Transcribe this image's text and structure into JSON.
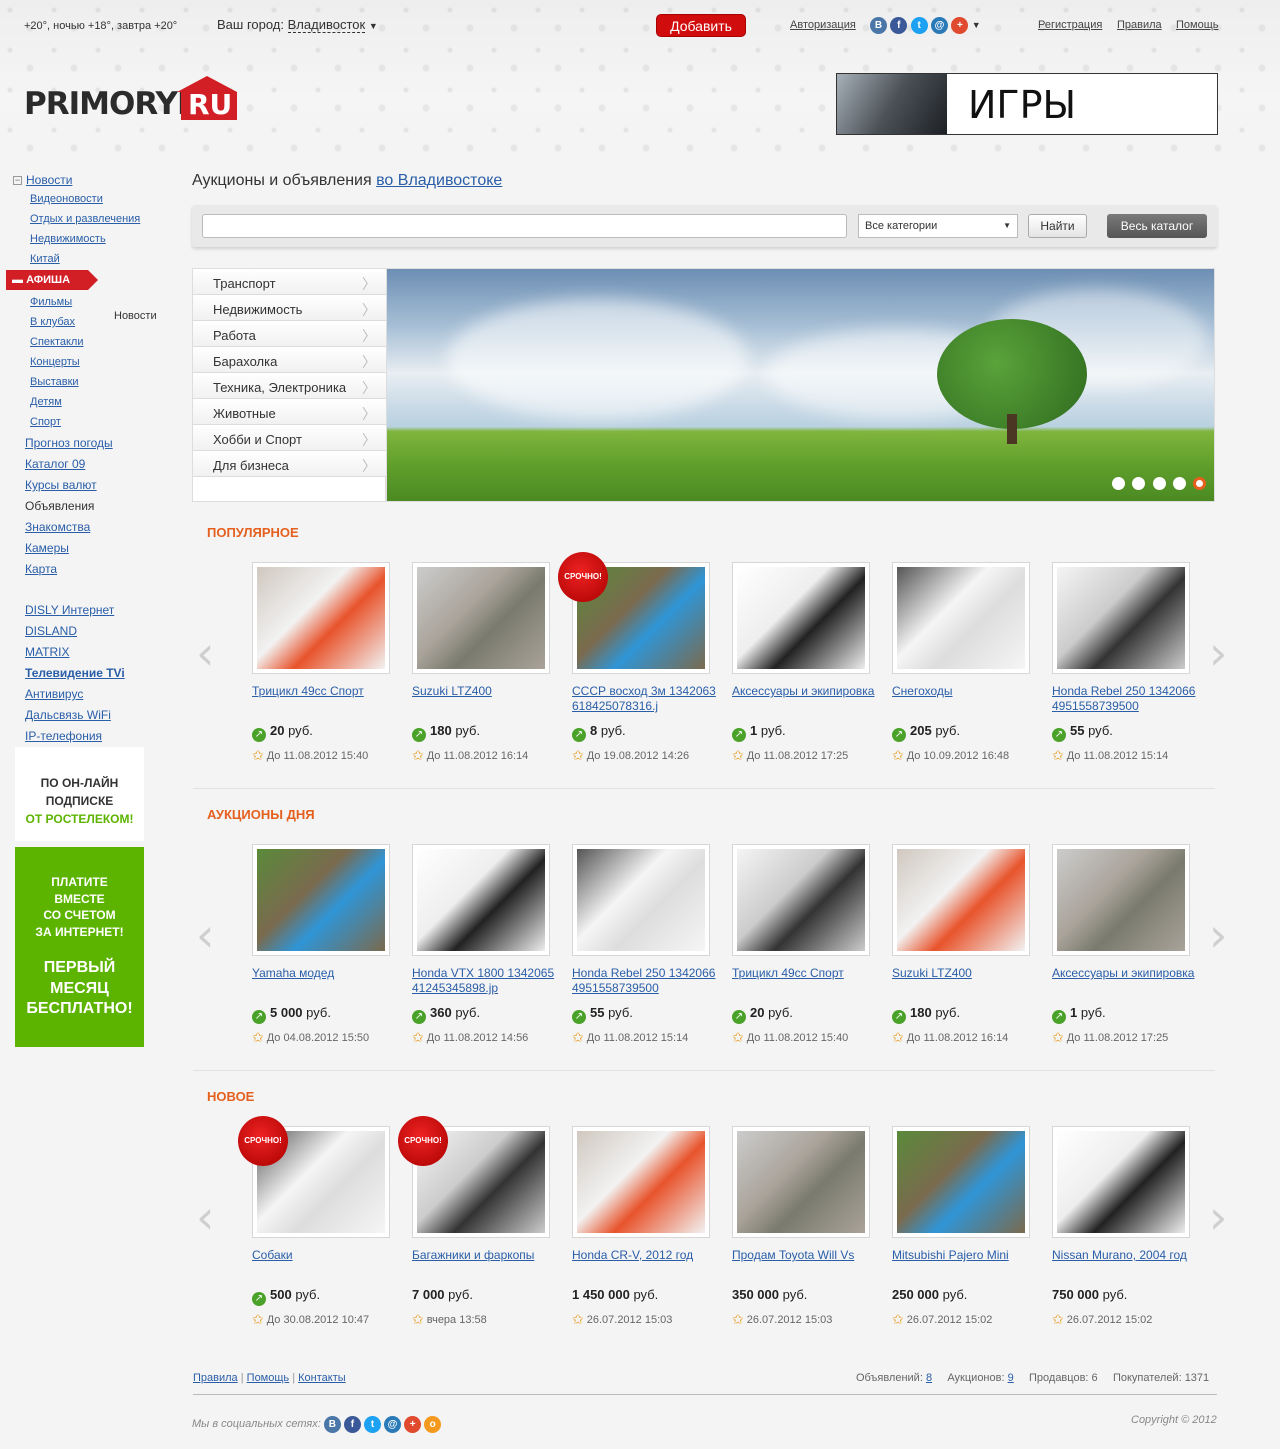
{
  "header": {
    "weather": "+20°, ночью +18°, завтра +20°",
    "city_label": "Ваш город:",
    "city": "Владивосток",
    "add_button": "Добавить",
    "auth": "Авторизация",
    "register": "Регистрация",
    "rules": "Правила",
    "help": "Помощь",
    "logo_main": "PRIMORYE",
    "logo_ru": "RU",
    "banner_text": "ИГРЫ",
    "social": [
      "В",
      "f",
      "t",
      "@",
      "+"
    ]
  },
  "nav": {
    "news": "Новости",
    "news_sub": [
      "Видеоновости",
      "Отдых и развлечения",
      "Недвижимость",
      "Китай"
    ],
    "afisha": "АФИША",
    "afisha_sub": [
      "Фильмы",
      "В клубах",
      "Спектакли",
      "Концерты",
      "Выставки",
      "Детям",
      "Спорт"
    ],
    "floating_label": "Новости",
    "main": [
      "Прогноз погоды",
      "Каталог 09",
      "Курсы валют",
      "Объявления",
      "Знакомства",
      "Камеры",
      "Карта"
    ],
    "partners": [
      "DISLY Интернет",
      "DISLAND",
      "MATRIX",
      "Телевидение TVi",
      "Антивирус",
      "Дальсвязь WiFi",
      "IP-телефония"
    ]
  },
  "ads": {
    "ad1": [
      "ПО ОН-ЛАЙН",
      "ПОДПИСКЕ",
      "ОТ РОСТЕЛЕКОМ!"
    ],
    "ad2_top": [
      "ПЛАТИТЕ",
      "ВМЕСТЕ",
      "СО СЧЕТОМ",
      "ЗА ИНТЕРНЕТ!"
    ],
    "ad2_bottom": [
      "ПЕРВЫЙ",
      "МЕСЯЦ",
      "БЕСПЛАТНО!"
    ]
  },
  "page": {
    "title": "Аукционы и объявления",
    "title_city": "во Владивостоке",
    "search_value": "",
    "category_select": "Все категории",
    "find_button": "Найти",
    "catalog_button": "Весь каталог"
  },
  "categories": [
    "Транспорт",
    "Недвижимость",
    "Работа",
    "Барахолка",
    "Техника, Электроника",
    "Животные",
    "Хобби и Спорт",
    "Для бизнеса"
  ],
  "sections": [
    {
      "title": "ПОПУЛЯРНОЕ",
      "items": [
        {
          "title": "Трицикл 49сс Спорт",
          "price": "20",
          "currency": "руб.",
          "date": "До 11.08.2012 15:40",
          "urgent": false,
          "auction": true
        },
        {
          "title": "Suzuki LTZ400",
          "price": "180",
          "currency": "руб.",
          "date": "До 11.08.2012 16:14",
          "urgent": false,
          "auction": true
        },
        {
          "title": "СССР восход 3м 1342063618425078316.j",
          "price": "8",
          "currency": "руб.",
          "date": "До 19.08.2012 14:26",
          "urgent": true,
          "auction": true
        },
        {
          "title": "Аксессуары и экипировка",
          "price": "1",
          "currency": "руб.",
          "date": "До 11.08.2012 17:25",
          "urgent": false,
          "auction": true
        },
        {
          "title": "Снегоходы",
          "price": "205",
          "currency": "руб.",
          "date": "До 10.09.2012 16:48",
          "urgent": false,
          "auction": true
        },
        {
          "title": "Honda Rebel 250 134206649515587395​00",
          "price": "55",
          "currency": "руб.",
          "date": "До 11.08.2012 15:14",
          "urgent": false,
          "auction": true
        }
      ]
    },
    {
      "title": "АУКЦИОНЫ ДНЯ",
      "items": [
        {
          "title": "Yamaha модед",
          "price": "5 000",
          "currency": "руб.",
          "date": "До 04.08.2012 15:50",
          "urgent": false,
          "auction": true
        },
        {
          "title": "Honda VTX 1800 134206541245345898.jp",
          "price": "360",
          "currency": "руб.",
          "date": "До 11.08.2012 14:56",
          "urgent": false,
          "auction": true
        },
        {
          "title": "Honda Rebel 250 134206649515587395​00",
          "price": "55",
          "currency": "руб.",
          "date": "До 11.08.2012 15:14",
          "urgent": false,
          "auction": true
        },
        {
          "title": "Трицикл 49сс Спорт",
          "price": "20",
          "currency": "руб.",
          "date": "До 11.08.2012 15:40",
          "urgent": false,
          "auction": true
        },
        {
          "title": "Suzuki LTZ400",
          "price": "180",
          "currency": "руб.",
          "date": "До 11.08.2012 16:14",
          "urgent": false,
          "auction": true
        },
        {
          "title": "Аксессуары и экипировка",
          "price": "1",
          "currency": "руб.",
          "date": "До 11.08.2012 17:25",
          "urgent": false,
          "auction": true
        }
      ]
    },
    {
      "title": "НОВОЕ",
      "items": [
        {
          "title": "Собаки",
          "price": "500",
          "currency": "руб.",
          "date": "До 30.08.2012 10:47",
          "urgent": true,
          "auction": true
        },
        {
          "title": "Багажники и фаркопы",
          "price": "7 000",
          "currency": "руб.",
          "date": "вчера 13:58",
          "urgent": true,
          "auction": false
        },
        {
          "title": "Honda CR-V, 2012 год",
          "price": "1 450 000",
          "currency": "руб.",
          "date": "26.07.2012 15:03",
          "urgent": false,
          "auction": false
        },
        {
          "title": "Продам Toyota Will Vs",
          "price": "350 000",
          "currency": "руб.",
          "date": "26.07.2012 15:03",
          "urgent": false,
          "auction": false
        },
        {
          "title": "Mitsubishi Pajero Mini",
          "price": "250 000",
          "currency": "руб.",
          "date": "26.07.2012 15:02",
          "urgent": false,
          "auction": false
        },
        {
          "title": "Nissan Murano, 2004 год",
          "price": "750 000",
          "currency": "руб.",
          "date": "26.07.2012 15:02",
          "urgent": false,
          "auction": false
        }
      ]
    }
  ],
  "urgent_label": "СРОЧНО!",
  "footer": {
    "links": [
      "Правила",
      "Помощь",
      "Контакты"
    ],
    "ads_label": "Объявлений:",
    "ads_count": "8",
    "auctions_label": "Аукционов:",
    "auctions_count": "9",
    "sellers": "Продавцов: 6",
    "buyers": "Покупателей: 1371",
    "social_label": "Мы в социальных сетях:",
    "social": [
      "В",
      "f",
      "t",
      "@",
      "+",
      "о"
    ],
    "copyright": "Copyright © 2012"
  },
  "colors": {
    "accent": "#d21f26",
    "section_title": "#e5601e",
    "link": "#2a5ea8",
    "ad_green": "#5cb400"
  }
}
